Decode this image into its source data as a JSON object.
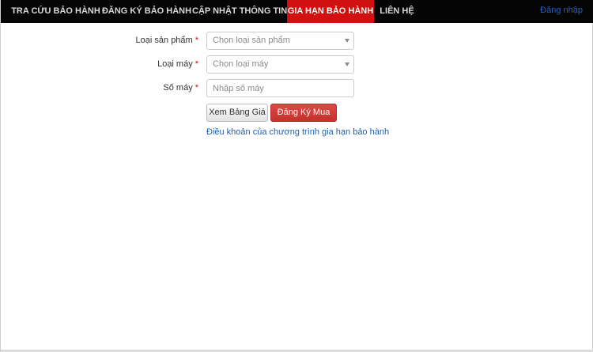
{
  "nav": {
    "items": [
      {
        "label": "TRA CỨU BẢO HÀNH",
        "active": false
      },
      {
        "label": "ĐĂNG KÝ BẢO HÀNH",
        "active": false
      },
      {
        "label": "CẬP NHẬT THÔNG TIN",
        "active": false
      },
      {
        "label": "GIA HẠN BẢO HÀNH",
        "active": true
      },
      {
        "label": "LIÊN HỆ",
        "active": false
      }
    ],
    "login_label": "Đăng nhập"
  },
  "form": {
    "product_type": {
      "label": "Loại sản phẩm",
      "required_mark": "*",
      "selected": "Chọn loại sản phẩm"
    },
    "machine_type": {
      "label": "Loại máy",
      "required_mark": "*",
      "selected": "Chọn loại máy"
    },
    "serial": {
      "label": "Số máy",
      "required_mark": "*",
      "value": "",
      "placeholder": "Nhập số máy"
    },
    "price_button_label": "Xem Bảng Giá",
    "buy_button_label": "Đăng Ký Mua",
    "terms_link": "Điều khoản của chương trình gia hạn bảo hành"
  },
  "colors": {
    "navbar_bg": "#050505",
    "active_tab": "#d0110f",
    "primary_action": "#c4302b",
    "link": "#1f5fae",
    "required": "#d0110f"
  }
}
